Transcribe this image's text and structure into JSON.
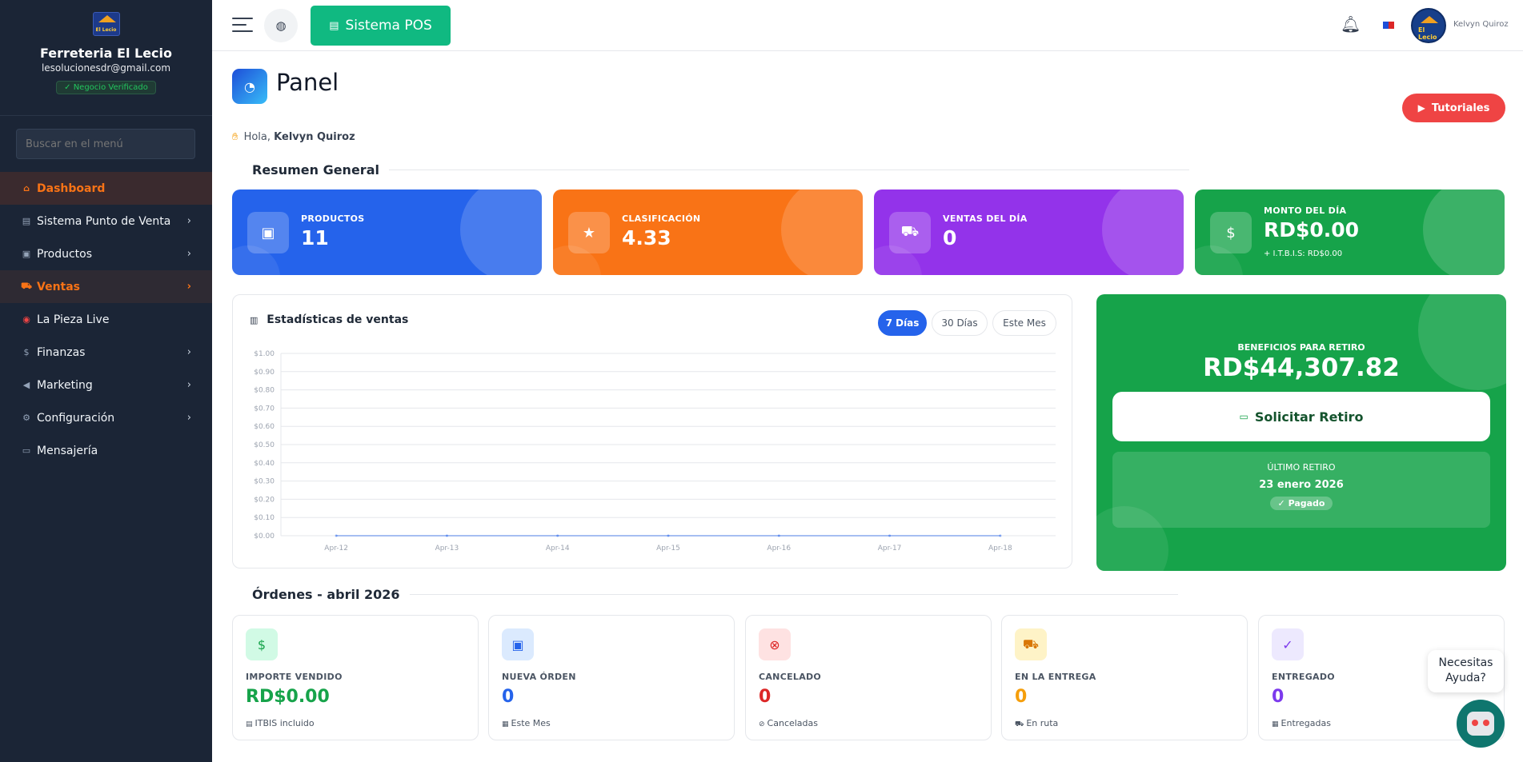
{
  "sidebar": {
    "business_name": "Ferreteria El Lecio",
    "email": "lesolucionesdr@gmail.com",
    "badge": "Negocio Verificado",
    "logo_text": "El Lecio",
    "search_placeholder": "Buscar en el menú",
    "items": [
      {
        "label": "Dashboard",
        "icon": "home-icon"
      },
      {
        "label": "Sistema Punto de Venta",
        "icon": "pos-icon"
      },
      {
        "label": "Productos",
        "icon": "box-icon"
      },
      {
        "label": "Ventas",
        "icon": "cart-icon"
      },
      {
        "label": "La Pieza Live",
        "icon": "live-icon"
      },
      {
        "label": "Finanzas",
        "icon": "dollar-icon"
      },
      {
        "label": "Marketing",
        "icon": "megaphone-icon"
      },
      {
        "label": "Configuración",
        "icon": "gear-icon"
      },
      {
        "label": "Mensajería",
        "icon": "chat-icon"
      }
    ]
  },
  "topbar": {
    "pos_button": "Sistema POS",
    "user_name": "Kelvyn Quiroz",
    "avatar_text": "El Lecio"
  },
  "page": {
    "title": "Panel",
    "tutorials_button": "Tutoriales",
    "greeting": "Hola,",
    "greeting_name": "Kelvyn Quiroz",
    "summary_title": "Resumen General",
    "orders_title": "Órdenes - abril 2026"
  },
  "stats": [
    {
      "label": "PRODUCTOS",
      "value": "11",
      "color": "#2563eb",
      "icon": "box-icon"
    },
    {
      "label": "CLASIFICACIÓN",
      "value": "4.33",
      "color": "#f97316",
      "icon": "star-icon"
    },
    {
      "label": "VENTAS DEL DÍA",
      "value": "0",
      "color": "#9333ea",
      "icon": "cart-icon"
    },
    {
      "label": "MONTO DEL DÍA",
      "value": "RD$0.00",
      "sub": "+ I.T.B.I.S: RD$0.00",
      "color": "#16a34a",
      "icon": "dollar-icon"
    }
  ],
  "sales_chart": {
    "title": "Estadísticas de ventas",
    "ranges": [
      "7 Días",
      "30 Días",
      "Este Mes"
    ],
    "active_range": "7 Días"
  },
  "chart_data": {
    "type": "line",
    "title": "Estadísticas de ventas",
    "x": [
      "Apr-12",
      "Apr-13",
      "Apr-14",
      "Apr-15",
      "Apr-16",
      "Apr-17",
      "Apr-18"
    ],
    "y_ticks": [
      "$0.00",
      "$0.10",
      "$0.20",
      "$0.30",
      "$0.40",
      "$0.50",
      "$0.60",
      "$0.70",
      "$0.80",
      "$0.90",
      "$1.00"
    ],
    "ylim": [
      0,
      1
    ],
    "series": [
      {
        "values": [
          0,
          0,
          0,
          0,
          0,
          0,
          0
        ]
      }
    ],
    "grid": true
  },
  "benefits": {
    "label": "BENEFICIOS PARA RETIRO",
    "value": "RD$44,307.82",
    "button": "Solicitar Retiro",
    "last_label": "ÚLTIMO RETIRO",
    "last_date": "23 enero 2026",
    "last_status": "Pagado"
  },
  "orders": [
    {
      "label": "IMPORTE VENDIDO",
      "value": "RD$0.00",
      "sub": "ITBIS incluido",
      "color": "#16a34a",
      "bg": "#d1fae5",
      "icon": "dollar-icon"
    },
    {
      "label": "NUEVA ÓRDEN",
      "value": "0",
      "sub": "Este Mes",
      "color": "#2563eb",
      "bg": "#dbeafe",
      "icon": "bag-icon"
    },
    {
      "label": "CANCELADO",
      "value": "0",
      "sub": "Canceladas",
      "color": "#dc2626",
      "bg": "#fee2e2",
      "icon": "cancel-icon"
    },
    {
      "label": "EN LA ENTREGA",
      "value": "0",
      "sub": "En ruta",
      "color": "#f59e0b",
      "bg": "#fef3c7",
      "icon": "truck-icon"
    },
    {
      "label": "ENTREGADO",
      "value": "0",
      "sub": "Entregadas",
      "color": "#7c3aed",
      "bg": "#ede9fe",
      "icon": "check-icon"
    }
  ],
  "help": {
    "line1": "Necesitas",
    "line2": "Ayuda?"
  }
}
